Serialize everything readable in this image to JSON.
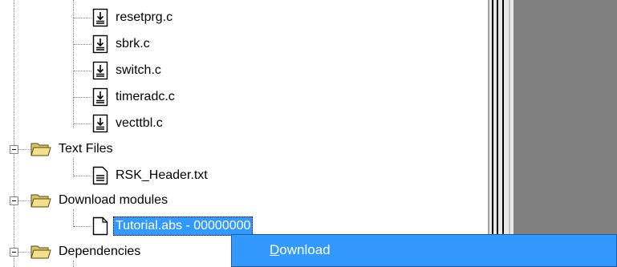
{
  "tree": {
    "files": [
      {
        "label": "resetprg.c",
        "icon": "source-file-icon"
      },
      {
        "label": "sbrk.c",
        "icon": "source-file-icon"
      },
      {
        "label": "switch.c",
        "icon": "source-file-icon"
      },
      {
        "label": "timeradc.c",
        "icon": "source-file-icon"
      },
      {
        "label": "vecttbl.c",
        "icon": "source-file-icon"
      }
    ],
    "text_files_folder": {
      "label": "Text Files",
      "icon": "folder-icon"
    },
    "text_files_children": [
      {
        "label": "RSK_Header.txt",
        "icon": "text-file-icon"
      }
    ],
    "download_modules_folder": {
      "label": "Download modules",
      "icon": "folder-icon"
    },
    "download_modules_children": [
      {
        "label": "Tutorial.abs - 00000000",
        "icon": "blank-file-icon",
        "selected": true
      }
    ],
    "dependencies_folder": {
      "label": "Dependencies",
      "icon": "folder-icon"
    }
  },
  "context_menu": {
    "items": [
      {
        "label_access": "D",
        "label_rest": "ownload",
        "highlighted": true
      }
    ]
  },
  "colors": {
    "selection": "#3399ff",
    "panel_gray": "#808080",
    "folder_yellow": "#f2e08e"
  }
}
